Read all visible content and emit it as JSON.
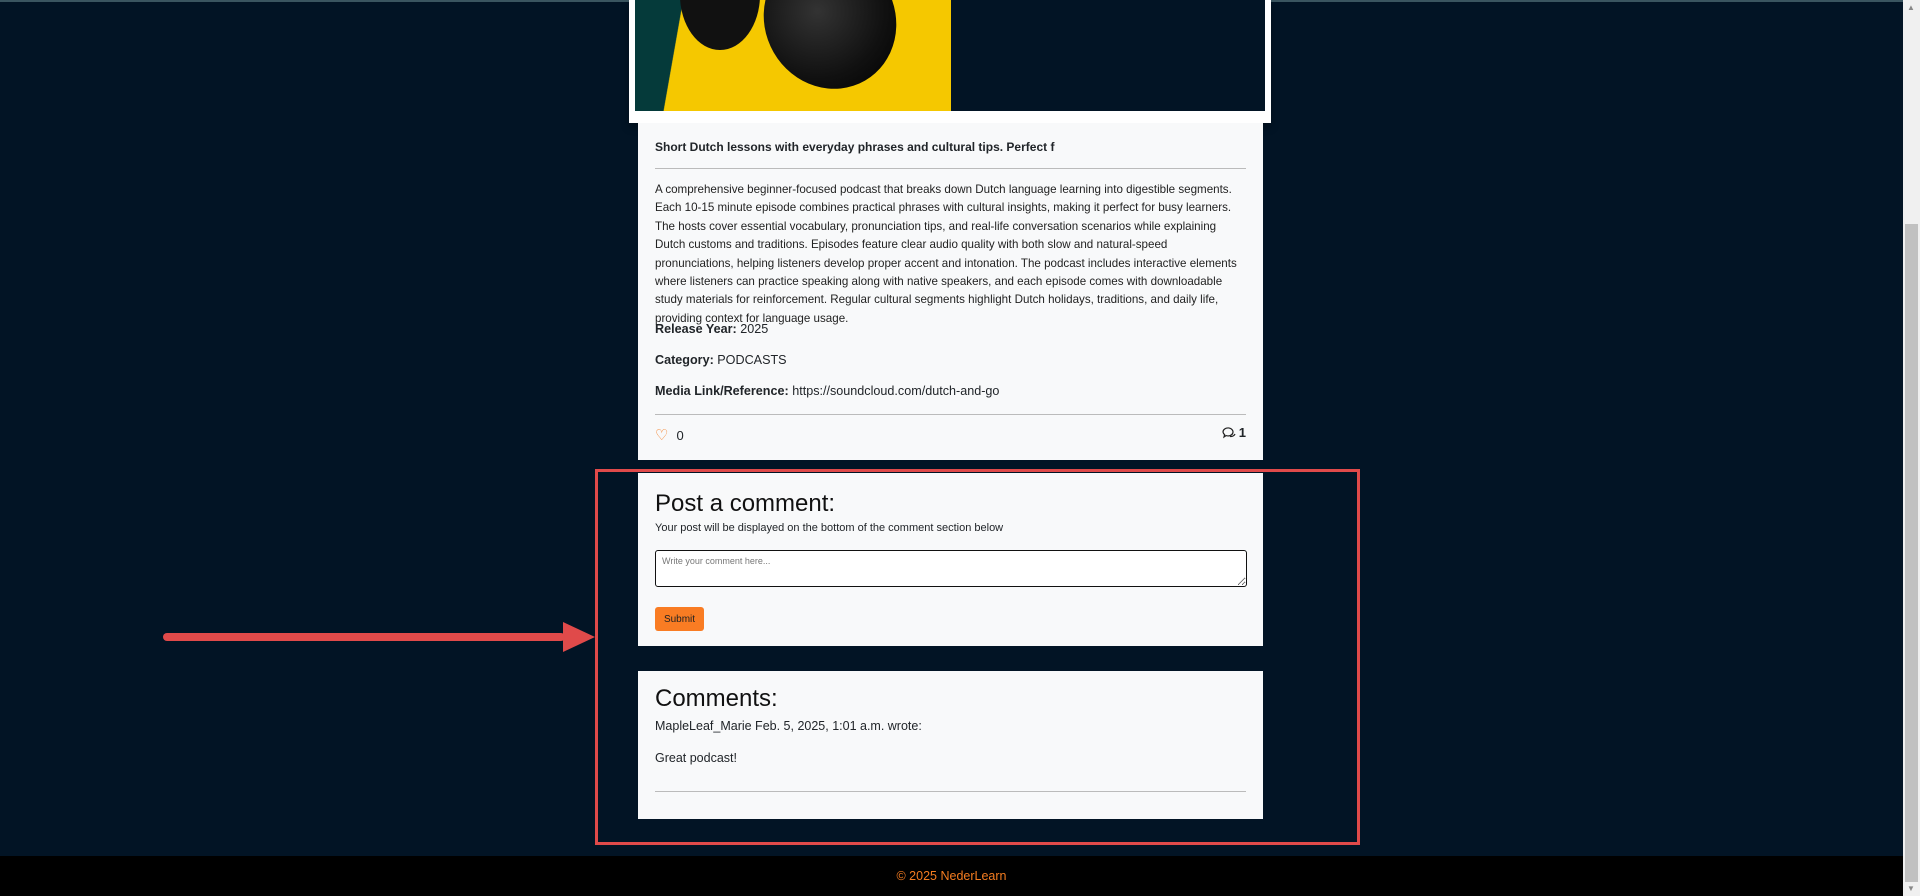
{
  "post": {
    "headline": "Short Dutch lessons with everyday phrases and cultural tips. Perfect f",
    "description": "A comprehensive beginner-focused podcast that breaks down Dutch language learning into digestible segments. Each 10-15 minute episode combines practical phrases with cultural insights, making it perfect for busy learners. The hosts cover essential vocabulary, pronunciation tips, and real-life conversation scenarios while explaining Dutch customs and traditions. Episodes feature clear audio quality with both slow and natural-speed pronunciations, helping listeners develop proper accent and intonation. The podcast includes interactive elements where listeners can practice speaking along with native speakers, and each episode comes with downloadable study materials for reinforcement. Regular cultural segments highlight Dutch holidays, traditions, and daily life, providing context for language usage.",
    "release_label": "Release Year:",
    "release_value": "2025",
    "category_label": "Category:",
    "category_value": "PODCASTS",
    "media_label": "Media Link/Reference:",
    "media_value": "https://soundcloud.com/dutch-and-go",
    "likes": "0",
    "comments_count": "1"
  },
  "comment_form": {
    "title": "Post a comment:",
    "subtitle": "Your post will be displayed on the bottom of the comment section below",
    "placeholder": "Write your comment here...",
    "submit_label": "Submit"
  },
  "comments": {
    "title": "Comments:",
    "items": [
      {
        "header": "MapleLeaf_Marie Feb. 5, 2025, 1:01 a.m. wrote:",
        "text": "Great podcast!"
      }
    ]
  },
  "footer": {
    "text": "© 2025 NederLearn"
  },
  "colors": {
    "accent": "#f97c23",
    "background": "#021425",
    "highlight": "#e04a4a"
  }
}
